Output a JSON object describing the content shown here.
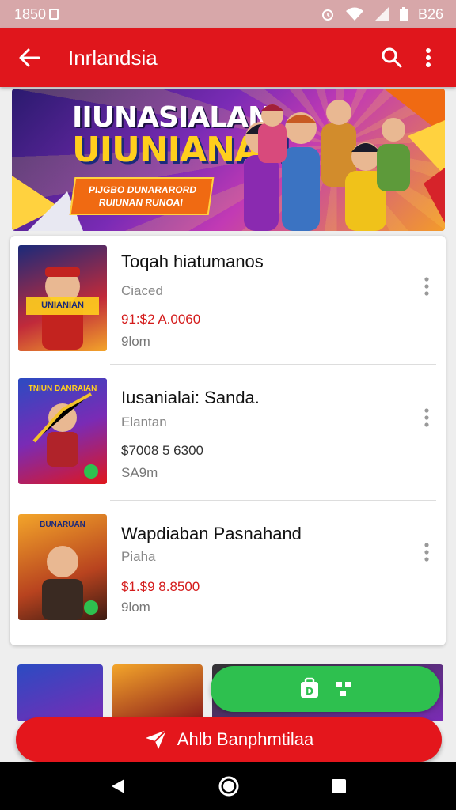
{
  "status_bar": {
    "time": "1850",
    "clock": "B26",
    "icons": [
      "image-icon",
      "alarm-icon",
      "wifi-icon",
      "signal-icon",
      "battery-icon"
    ]
  },
  "app_bar": {
    "title": "Inrlandsia",
    "back_icon": "arrow-left-icon",
    "search_icon": "search-icon",
    "menu_icon": "more-vert-icon",
    "color": "#e0161c"
  },
  "banner": {
    "title_line1": "IIUNASIALAN",
    "title_line2": "UIUNIANAN",
    "tag_line1": "PIJGBO DUNARARORD",
    "tag_line2": "RUIUNAN RUNOAI"
  },
  "items": [
    {
      "name": "Toqah hiatumanos",
      "subtitle": "Ciaced",
      "price": "91:$2 A.0060",
      "size": "9lom",
      "thumb_text": "UNIANIAN"
    },
    {
      "name": "Iusanialai: Sanda.",
      "subtitle": "Elantan",
      "price": "$7008 5 6300",
      "size": "SA9m",
      "thumb_text": "TNIUN DANRAIAN"
    },
    {
      "name": "Wapdiaban Pasnahand",
      "subtitle": "Piaha",
      "price": "$1.$9 8.8500",
      "size": "9lom",
      "thumb_text": "BUNARUAN"
    }
  ],
  "buttons": {
    "primary_label": "Ahlb Banphmtilaa",
    "secondary_label": ""
  },
  "colors": {
    "accent": "#e0161c",
    "green": "#2ec04f",
    "price": "#d41b1b"
  },
  "nav": {
    "back": "back-triangle-icon",
    "home": "home-circle-icon",
    "recents": "recents-square-icon"
  }
}
